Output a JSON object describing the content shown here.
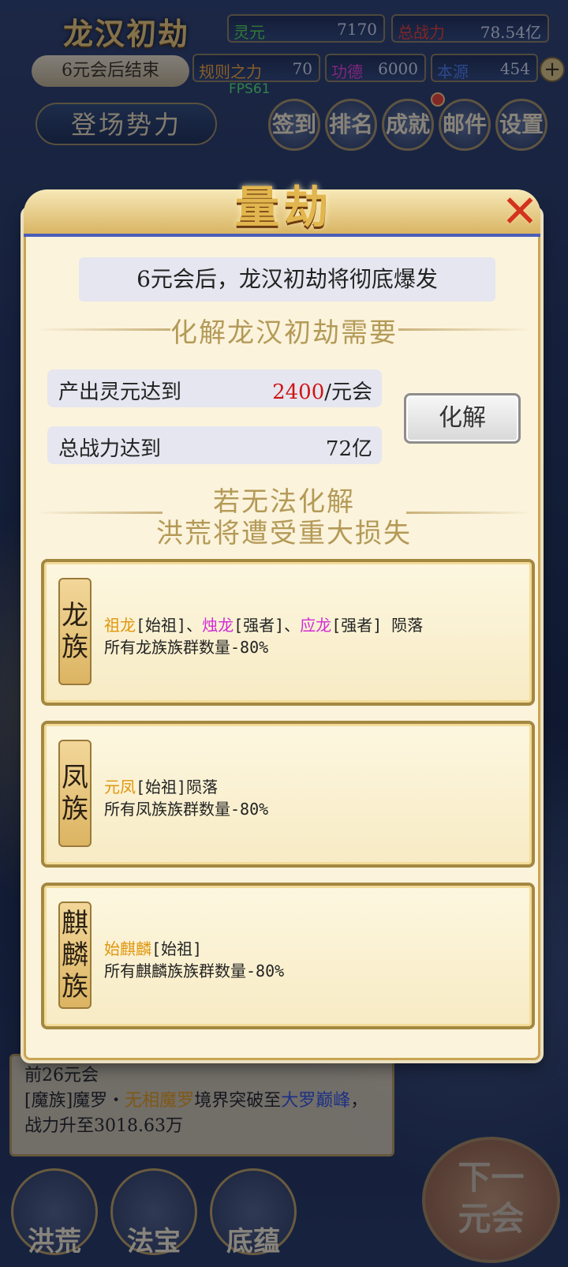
{
  "hud": {
    "title": "龙汉初劫",
    "countdown": "6元会后结束",
    "fps": "FPS61",
    "force_button": "登场势力",
    "resources": [
      {
        "label": "灵元",
        "value": "7170",
        "color": "#4fd34f"
      },
      {
        "label": "总战力",
        "value": "78.54亿",
        "color": "#e23b2b"
      },
      {
        "label": "规则之力",
        "value": "70",
        "color": "#f0a030"
      },
      {
        "label": "功德",
        "value": "6000",
        "color": "#e23bd0"
      },
      {
        "label": "本源",
        "value": "454",
        "color": "#4a7ae8"
      }
    ],
    "nav": [
      "签到",
      "排名",
      "成就",
      "邮件",
      "设置"
    ]
  },
  "modal": {
    "title": "量劫",
    "banner": "6元会后，龙汉初劫将彻底爆发",
    "requirements_title": "化解龙汉初劫需要",
    "requirements": [
      {
        "label": "产出灵元达到",
        "value_highlight": "2400",
        "value_suffix": "/元会"
      },
      {
        "label": "总战力达到",
        "value_highlight": "",
        "value_suffix": "72亿"
      }
    ],
    "resolve_button": "化解",
    "failure_line1": "若无法化解",
    "failure_line2": "洪荒将遭受重大损失",
    "clans": [
      {
        "tag": [
          "龙",
          "族"
        ],
        "parts": [
          {
            "t": "祖龙",
            "c": "gold"
          },
          {
            "t": "[始祖]、",
            "c": ""
          },
          {
            "t": "烛龙",
            "c": "pink"
          },
          {
            "t": "[强者]、",
            "c": ""
          },
          {
            "t": "应龙",
            "c": "pink"
          },
          {
            "t": "[强者] 陨落",
            "c": ""
          }
        ],
        "effect": "所有龙族族群数量-80%"
      },
      {
        "tag": [
          "凤",
          "族"
        ],
        "parts": [
          {
            "t": "元凤",
            "c": "gold"
          },
          {
            "t": "[始祖]陨落",
            "c": ""
          }
        ],
        "effect": "所有凤族族群数量-80%"
      },
      {
        "tag": [
          "麒",
          "麟",
          "族"
        ],
        "parts": [
          {
            "t": "始麒麟",
            "c": "gold"
          },
          {
            "t": "[始祖]",
            "c": ""
          }
        ],
        "effect": "所有麒麟族族群数量-80%"
      }
    ]
  },
  "log": {
    "time": "前26元会",
    "prefix": "[魔族]魔罗・",
    "name": "无相魔罗",
    "mid": "境界突破至",
    "realm": "大罗巅峰",
    "suffix": "，战力升至3018.63万"
  },
  "bottom_nav": [
    "洪荒",
    "法宝",
    "底蕴"
  ],
  "next_button": [
    "下一",
    "元会"
  ]
}
